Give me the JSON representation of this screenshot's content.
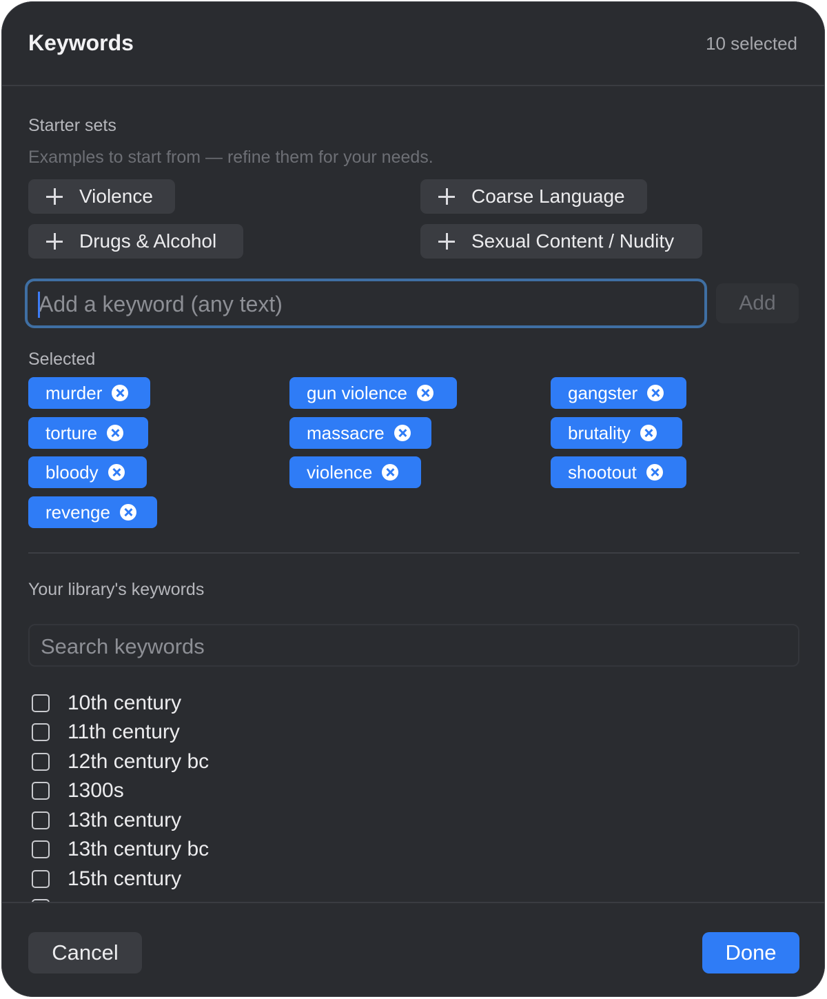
{
  "header": {
    "title": "Keywords",
    "count": "10 selected"
  },
  "starter": {
    "label": "Starter sets",
    "hint": "Examples to start from — refine them for your needs.",
    "items": [
      "Violence",
      "Coarse Language",
      "Drugs & Alcohol",
      "Sexual Content / Nudity"
    ]
  },
  "keyword_input": {
    "placeholder": "Add a keyword (any text)",
    "value": ""
  },
  "add_label": "Add",
  "selected": {
    "label": "Selected",
    "chips": [
      "murder",
      "gun violence",
      "gangster",
      "torture",
      "massacre",
      "brutality",
      "bloody",
      "violence",
      "shootout",
      "revenge"
    ]
  },
  "library": {
    "label": "Your library's keywords",
    "search_placeholder": "Search keywords",
    "items": [
      "10th century",
      "11th century",
      "12th century bc",
      "1300s",
      "13th century",
      "13th century bc",
      "15th century"
    ]
  },
  "footer": {
    "cancel": "Cancel",
    "done": "Done"
  },
  "colors": {
    "accent": "#2f7cf6",
    "background": "#2a2c30",
    "button": "#3a3c41"
  },
  "icons": {
    "starter": "plus-icon",
    "chip_remove": "close-circle-icon"
  }
}
